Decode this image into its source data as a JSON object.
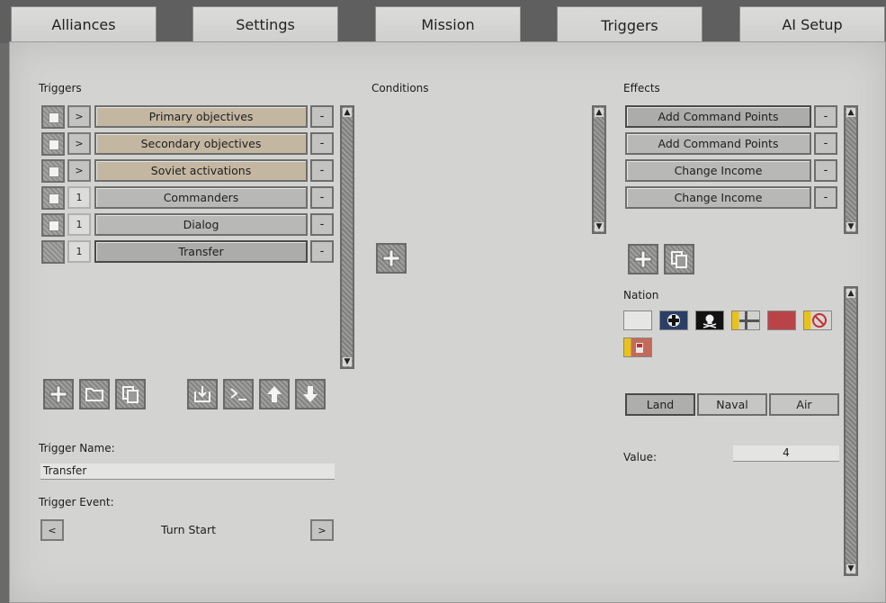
{
  "tabs": [
    {
      "label": "Alliances"
    },
    {
      "label": "Settings"
    },
    {
      "label": "Mission"
    },
    {
      "label": "Triggers"
    },
    {
      "label": "AI Setup"
    }
  ],
  "active_tab": "Triggers",
  "triggers": {
    "heading": "Triggers",
    "items": [
      {
        "expand": ">",
        "label": "Primary objectives",
        "remove": "-",
        "type": "objective"
      },
      {
        "expand": ">",
        "label": "Secondary objectives",
        "remove": "-",
        "type": "objective"
      },
      {
        "expand": ">",
        "label": "Soviet activations",
        "remove": "-",
        "type": "objective"
      },
      {
        "expand": "1",
        "label": "Commanders",
        "remove": "-",
        "type": "trigger"
      },
      {
        "expand": "1",
        "label": "Dialog",
        "remove": "-",
        "type": "trigger"
      },
      {
        "expand": "1",
        "label": "Transfer",
        "remove": "-",
        "type": "trigger",
        "selected": true
      }
    ],
    "toolbar": [
      {
        "icon": "plus-icon"
      },
      {
        "icon": "folder-icon"
      },
      {
        "icon": "copy-icon"
      },
      {
        "icon": "import-icon"
      },
      {
        "icon": "console-icon"
      },
      {
        "icon": "arrow-up-icon"
      },
      {
        "icon": "arrow-down-icon"
      }
    ],
    "name_label": "Trigger Name:",
    "name_value": "Transfer",
    "event_label": "Trigger Event:",
    "event_prev": "<",
    "event_value": "Turn Start",
    "event_next": ">"
  },
  "conditions": {
    "heading": "Conditions",
    "add_icon": "plus-icon"
  },
  "effects": {
    "heading": "Effects",
    "items": [
      {
        "label": "Add Command Points",
        "remove": "-",
        "selected": true
      },
      {
        "label": "Add Command Points",
        "remove": "-"
      },
      {
        "label": "Change Income",
        "remove": "-"
      },
      {
        "label": "Change Income",
        "remove": "-"
      }
    ],
    "add_icon": "plus-icon",
    "copy_icon": "copy-icon",
    "nation_label": "Nation",
    "nations": [
      {
        "icon": "white-flag-icon"
      },
      {
        "icon": "german-cross-flag-icon"
      },
      {
        "icon": "skull-flag-icon"
      },
      {
        "icon": "finnish-cross-flag-icon"
      },
      {
        "icon": "red-flag-icon"
      },
      {
        "icon": "none-flag-icon"
      },
      {
        "icon": "vatican-flag-icon"
      }
    ],
    "domains": [
      {
        "label": "Land",
        "active": true
      },
      {
        "label": "Naval"
      },
      {
        "label": "Air"
      }
    ],
    "value_label": "Value:",
    "value": "4"
  },
  "colors": {
    "panel": "#d3d3d1",
    "objective": "#c4b7a1",
    "trigger": "#b8b8b6"
  }
}
